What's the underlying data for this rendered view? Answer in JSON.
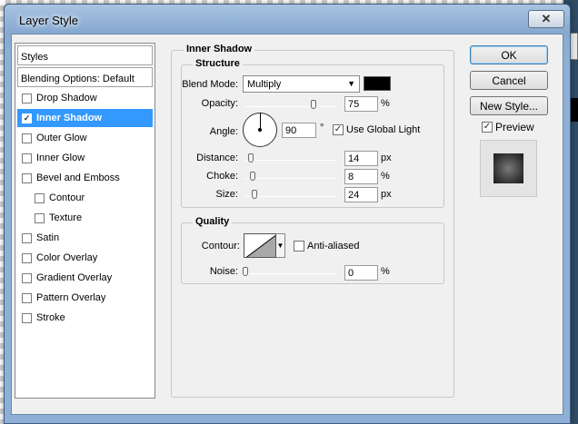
{
  "window": {
    "title": "Layer Style",
    "close_symbol": "✕"
  },
  "styles_list": {
    "header": "Styles",
    "blending": "Blending Options: Default",
    "items": [
      {
        "label": "Drop Shadow",
        "checked": false,
        "selected": false
      },
      {
        "label": "Inner Shadow",
        "checked": true,
        "selected": true
      },
      {
        "label": "Outer Glow",
        "checked": false,
        "selected": false
      },
      {
        "label": "Inner Glow",
        "checked": false,
        "selected": false
      },
      {
        "label": "Bevel and Emboss",
        "checked": false,
        "selected": false
      },
      {
        "label": "Contour",
        "checked": false,
        "selected": false
      },
      {
        "label": "Texture",
        "checked": false,
        "selected": false
      },
      {
        "label": "Satin",
        "checked": false,
        "selected": false
      },
      {
        "label": "Color Overlay",
        "checked": false,
        "selected": false
      },
      {
        "label": "Gradient Overlay",
        "checked": false,
        "selected": false
      },
      {
        "label": "Pattern Overlay",
        "checked": false,
        "selected": false
      },
      {
        "label": "Stroke",
        "checked": false,
        "selected": false
      }
    ]
  },
  "inner_shadow": {
    "title": "Inner Shadow",
    "structure": {
      "title": "Structure",
      "blend_mode_label": "Blend Mode:",
      "blend_mode_value": "Multiply",
      "shadow_color": "#000000",
      "opacity_label": "Opacity:",
      "opacity_value": "75",
      "opacity_unit": "%",
      "angle_label": "Angle:",
      "angle_value": "90",
      "angle_unit": "°",
      "global_light_label": "Use Global Light",
      "global_light_checked": true,
      "distance_label": "Distance:",
      "distance_value": "14",
      "distance_unit": "px",
      "choke_label": "Choke:",
      "choke_value": "8",
      "choke_unit": "%",
      "size_label": "Size:",
      "size_value": "24",
      "size_unit": "px"
    },
    "quality": {
      "title": "Quality",
      "contour_label": "Contour:",
      "anti_aliased_label": "Anti-aliased",
      "anti_aliased_checked": false,
      "noise_label": "Noise:",
      "noise_value": "0",
      "noise_unit": "%"
    }
  },
  "buttons": {
    "ok": "OK",
    "cancel": "Cancel",
    "new_style": "New Style...",
    "preview_label": "Preview",
    "preview_checked": true
  },
  "check_mark": "✓",
  "dropdown_arrow": "▼"
}
